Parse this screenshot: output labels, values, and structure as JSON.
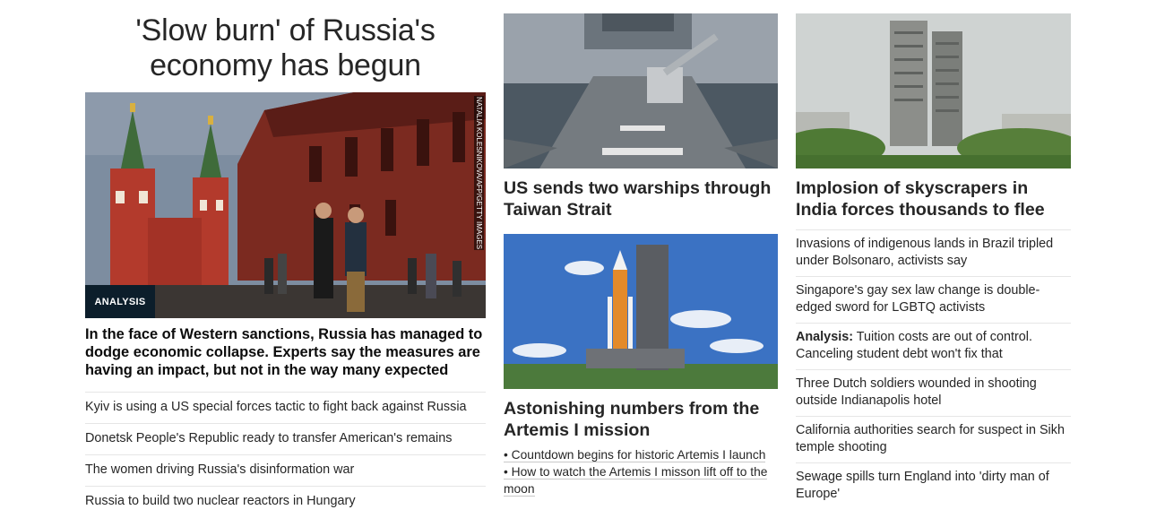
{
  "main_story": {
    "headline": "'Slow burn' of Russia's economy has begun",
    "image_alt": "Pedestrians near Red Square in Moscow",
    "credit": "NATALIA KOLESNIKOVA/AFP/GETTY IMAGES",
    "badge": "ANALYSIS",
    "summary": "In the face of Western sanctions, Russia has managed to dodge economic collapse. Experts say the measures are having an impact, but not in the way many expected",
    "related": [
      "Kyiv is using a US special forces tactic to fight back against Russia",
      "Donetsk People's Republic ready to transfer American's remains",
      "The women driving Russia's disinformation war",
      "Russia to build two nuclear reactors in Hungary"
    ]
  },
  "middle": {
    "story1": {
      "title": "US sends two warships through Taiwan Strait"
    },
    "story2": {
      "title": "Astonishing numbers from the Artemis I mission",
      "bullets": [
        "• Countdown begins for historic Artemis I launch",
        "• How to watch the Artemis I misson lift off to the moon"
      ]
    }
  },
  "right": {
    "story": {
      "title": "Implosion of skyscrapers in India forces thousands to flee"
    },
    "links": [
      {
        "label": "",
        "text": "Invasions of indigenous lands in Brazil tripled under Bolsonaro, activists say"
      },
      {
        "label": "",
        "text": "Singapore's gay sex law change is double-edged sword for LGBTQ activists"
      },
      {
        "label": "Analysis:",
        "text": " Tuition costs are out of control. Canceling student debt won't fix that"
      },
      {
        "label": "",
        "text": "Three Dutch soldiers wounded in shooting outside Indianapolis hotel"
      },
      {
        "label": "",
        "text": "California authorities search for suspect in Sikh temple shooting"
      },
      {
        "label": "",
        "text": "Sewage spills turn England into 'dirty man of Europe'"
      }
    ]
  },
  "colors": {
    "text": "#0c0c0c",
    "badge_bg": "#0c1e2b",
    "divider": "#e6e6e6"
  }
}
